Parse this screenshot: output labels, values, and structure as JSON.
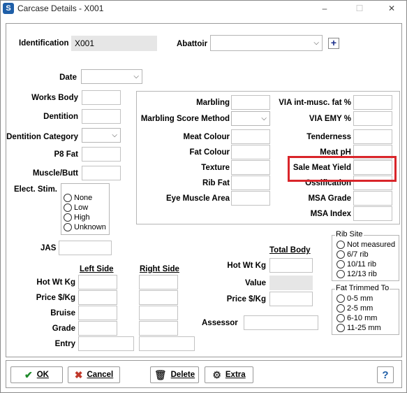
{
  "window": {
    "title": "Carcase Details - X001",
    "icon": "app-s-icon",
    "controls": [
      "–",
      "☐",
      "✕"
    ]
  },
  "header": {
    "identification_label": "Identification",
    "identification_value": "X001",
    "abattoir_label": "Abattoir",
    "abattoir_value": "",
    "add_label": "+"
  },
  "left": {
    "date_label": "Date",
    "works_body_label": "Works Body",
    "dentition_label": "Dentition",
    "dentition_category_label": "Dentition Category",
    "p8_fat_label": "P8 Fat",
    "muscle_butt_label": "Muscle/Butt",
    "elect_stim_label": "Elect. Stim.",
    "elect_stim_options": [
      "None",
      "Low",
      "High",
      "Unknown"
    ],
    "jas_label": "JAS"
  },
  "middle": {
    "marbling": "Marbling",
    "marbling_score_method": "Marbling Score Method",
    "meat_colour": "Meat Colour",
    "fat_colour": "Fat Colour",
    "texture": "Texture",
    "rib_fat": "Rib Fat",
    "eye_muscle_area": "Eye Muscle Area"
  },
  "right": {
    "via_int_musc_fat": "VIA int-musc. fat %",
    "via_emy": "VIA EMY %",
    "tenderness": "Tenderness",
    "meat_ph": "Meat pH",
    "sale_meat_yield": "Sale Meat Yield",
    "ossification": "Ossification",
    "msa_grade": "MSA Grade",
    "msa_index": "MSA Index"
  },
  "sides": {
    "left_side": "Left Side",
    "right_side": "Right Side",
    "hot_wt_kg": "Hot Wt Kg",
    "price_kg": "Price $/Kg",
    "bruise": "Bruise",
    "grade": "Grade",
    "entry": "Entry"
  },
  "total": {
    "total_body": "Total Body",
    "hot_wt_kg": "Hot Wt Kg",
    "value": "Value",
    "price_kg": "Price $/Kg",
    "assessor": "Assessor"
  },
  "rib_site": {
    "title": "Rib Site",
    "options": [
      "Not measured",
      "6/7 rib",
      "10/11 rib",
      "12/13 rib"
    ]
  },
  "fat_trimmed": {
    "title": "Fat Trimmed To",
    "options": [
      "0-5 mm",
      "2-5 mm",
      "6-10 mm",
      "11-25 mm"
    ]
  },
  "buttons": {
    "ok": "OK",
    "cancel": "Cancel",
    "delete": "Delete",
    "extra": "Extra",
    "help": "?"
  },
  "colors": {
    "accent_blue": "#1f5fa8",
    "highlight_red": "#d9252a"
  }
}
